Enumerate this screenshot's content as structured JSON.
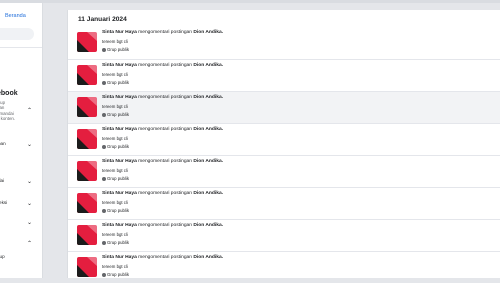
{
  "sidebar": {
    "home_label": "Beranda",
    "section_title": "ebook",
    "section_desc": "ikup\ndan\nemandai\na konten.",
    "nav_items": [
      {
        "label": "pan",
        "chevron": "chevron-down-icon"
      },
      {
        "label": "dai",
        "chevron": "chevron-down-icon"
      },
      {
        "label": "leksi",
        "chevron": "chevron-down-icon"
      },
      {
        "label": "",
        "chevron": "chevron-down-icon"
      },
      {
        "label": "rup",
        "chevron": "chevron-up-icon"
      }
    ],
    "section_chevron": "chevron-up-icon"
  },
  "feed": {
    "date_header": "11 Januari 2024",
    "items": [
      {
        "actor": "Sinta Nur Haya",
        "verb": "mengomentari postingan",
        "target": "Dion Andika.",
        "comment": "tereem bgt cli",
        "group": "Grup publik"
      },
      {
        "actor": "Sinta Nur Haya",
        "verb": "mengomentari postingan",
        "target": "Dion Andika.",
        "comment": "tereem bgt cli",
        "group": "Grup publik"
      },
      {
        "actor": "Sinta Nur Haya",
        "verb": "mengomentari postingan",
        "target": "Dion Andika.",
        "comment": "tereem bgt cli",
        "group": "Grup publik"
      },
      {
        "actor": "Sinta Nur Haya",
        "verb": "mengomentari postingan",
        "target": "Dion Andika.",
        "comment": "tereem bgt cli",
        "group": "Grup publik"
      },
      {
        "actor": "Sinta Nur Haya",
        "verb": "mengomentari postingan",
        "target": "Dion Andika.",
        "comment": "tereem bgt cli",
        "group": "Grup publik"
      },
      {
        "actor": "Sinta Nur Haya",
        "verb": "mengomentari postingan",
        "target": "Dion Andika.",
        "comment": "tereem bgt cli",
        "group": "Grup publik"
      },
      {
        "actor": "Sinta Nur Haya",
        "verb": "mengomentari postingan",
        "target": "Dion Andika.",
        "comment": "tereem bgt cli",
        "group": "Grup publik"
      },
      {
        "actor": "Sinta Nur Haya",
        "verb": "mengomentari postingan",
        "target": "Dion Andika.",
        "comment": "tereem bgt cli",
        "group": "Grup publik"
      }
    ]
  },
  "colors": {
    "link": "#216fdb",
    "thumb_red": "#e41e3f",
    "thumb_dark": "#1c1c1c",
    "row_shade": "#f2f3f5"
  },
  "icons": {
    "thumbnail": "group-thumbnail-icon",
    "privacy": "globe-icon"
  }
}
